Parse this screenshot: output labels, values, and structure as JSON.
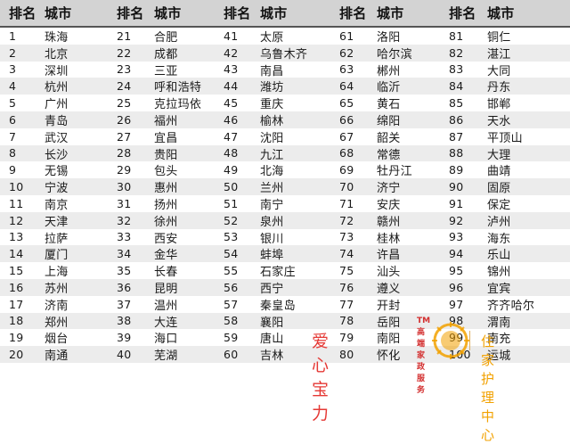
{
  "headers": {
    "rank": "排名",
    "city": "城市"
  },
  "rows": [
    [
      [
        "1",
        "珠海"
      ],
      [
        "21",
        "合肥"
      ],
      [
        "41",
        "太原"
      ],
      [
        "61",
        "洛阳"
      ],
      [
        "81",
        "铜仁"
      ]
    ],
    [
      [
        "2",
        "北京"
      ],
      [
        "22",
        "成都"
      ],
      [
        "42",
        "乌鲁木齐"
      ],
      [
        "62",
        "哈尔滨"
      ],
      [
        "82",
        "湛江"
      ]
    ],
    [
      [
        "3",
        "深圳"
      ],
      [
        "23",
        "三亚"
      ],
      [
        "43",
        "南昌"
      ],
      [
        "63",
        "郴州"
      ],
      [
        "83",
        "大同"
      ]
    ],
    [
      [
        "4",
        "杭州"
      ],
      [
        "24",
        "呼和浩特"
      ],
      [
        "44",
        "潍坊"
      ],
      [
        "64",
        "临沂"
      ],
      [
        "84",
        "丹东"
      ]
    ],
    [
      [
        "5",
        "广州"
      ],
      [
        "25",
        "克拉玛依"
      ],
      [
        "45",
        "重庆"
      ],
      [
        "65",
        "黄石"
      ],
      [
        "85",
        "邯郸"
      ]
    ],
    [
      [
        "6",
        "青岛"
      ],
      [
        "26",
        "福州"
      ],
      [
        "46",
        "榆林"
      ],
      [
        "66",
        "绵阳"
      ],
      [
        "86",
        "天水"
      ]
    ],
    [
      [
        "7",
        "武汉"
      ],
      [
        "27",
        "宜昌"
      ],
      [
        "47",
        "沈阳"
      ],
      [
        "67",
        "韶关"
      ],
      [
        "87",
        "平顶山"
      ]
    ],
    [
      [
        "8",
        "长沙"
      ],
      [
        "28",
        "贵阳"
      ],
      [
        "48",
        "九江"
      ],
      [
        "68",
        "常德"
      ],
      [
        "88",
        "大理"
      ]
    ],
    [
      [
        "9",
        "无锡"
      ],
      [
        "29",
        "包头"
      ],
      [
        "49",
        "北海"
      ],
      [
        "69",
        "牡丹江"
      ],
      [
        "89",
        "曲靖"
      ]
    ],
    [
      [
        "10",
        "宁波"
      ],
      [
        "30",
        "惠州"
      ],
      [
        "50",
        "兰州"
      ],
      [
        "70",
        "济宁"
      ],
      [
        "90",
        "固原"
      ]
    ],
    [
      [
        "11",
        "南京"
      ],
      [
        "31",
        "扬州"
      ],
      [
        "51",
        "南宁"
      ],
      [
        "71",
        "安庆"
      ],
      [
        "91",
        "保定"
      ]
    ],
    [
      [
        "12",
        "天津"
      ],
      [
        "32",
        "徐州"
      ],
      [
        "52",
        "泉州"
      ],
      [
        "72",
        "赣州"
      ],
      [
        "92",
        "泸州"
      ]
    ],
    [
      [
        "13",
        "拉萨"
      ],
      [
        "33",
        "西安"
      ],
      [
        "53",
        "银川"
      ],
      [
        "73",
        "桂林"
      ],
      [
        "93",
        "海东"
      ]
    ],
    [
      [
        "14",
        "厦门"
      ],
      [
        "34",
        "金华"
      ],
      [
        "54",
        "蚌埠"
      ],
      [
        "74",
        "许昌"
      ],
      [
        "94",
        "乐山"
      ]
    ],
    [
      [
        "15",
        "上海"
      ],
      [
        "35",
        "长春"
      ],
      [
        "55",
        "石家庄"
      ],
      [
        "75",
        "汕头"
      ],
      [
        "95",
        "锦州"
      ]
    ],
    [
      [
        "16",
        "苏州"
      ],
      [
        "36",
        "昆明"
      ],
      [
        "56",
        "西宁"
      ],
      [
        "76",
        "遵义"
      ],
      [
        "96",
        "宜宾"
      ]
    ],
    [
      [
        "17",
        "济南"
      ],
      [
        "37",
        "温州"
      ],
      [
        "57",
        "秦皇岛"
      ],
      [
        "77",
        "开封"
      ],
      [
        "97",
        "齐齐哈尔"
      ]
    ],
    [
      [
        "18",
        "郑州"
      ],
      [
        "38",
        "大连"
      ],
      [
        "58",
        "襄阳"
      ],
      [
        "78",
        "岳阳"
      ],
      [
        "98",
        "渭南"
      ]
    ],
    [
      [
        "19",
        "烟台"
      ],
      [
        "39",
        "海口"
      ],
      [
        "59",
        "唐山"
      ],
      [
        "79",
        "南阳"
      ],
      [
        "99",
        "南充"
      ]
    ],
    [
      [
        "20",
        "南通"
      ],
      [
        "40",
        "芜湖"
      ],
      [
        "60",
        "吉林"
      ],
      [
        "80",
        "怀化"
      ],
      [
        "100",
        "运城"
      ]
    ]
  ],
  "watermark": {
    "sub_text": "TM 高端家政服务",
    "brand_text": "爱心宝力",
    "right_text": "住家护理中心"
  },
  "colors": {
    "header_bg": "#d3d3d3",
    "alt_row_bg": "#ececec",
    "watermark_red": "#e53935",
    "watermark_gold": "#f2a100"
  }
}
